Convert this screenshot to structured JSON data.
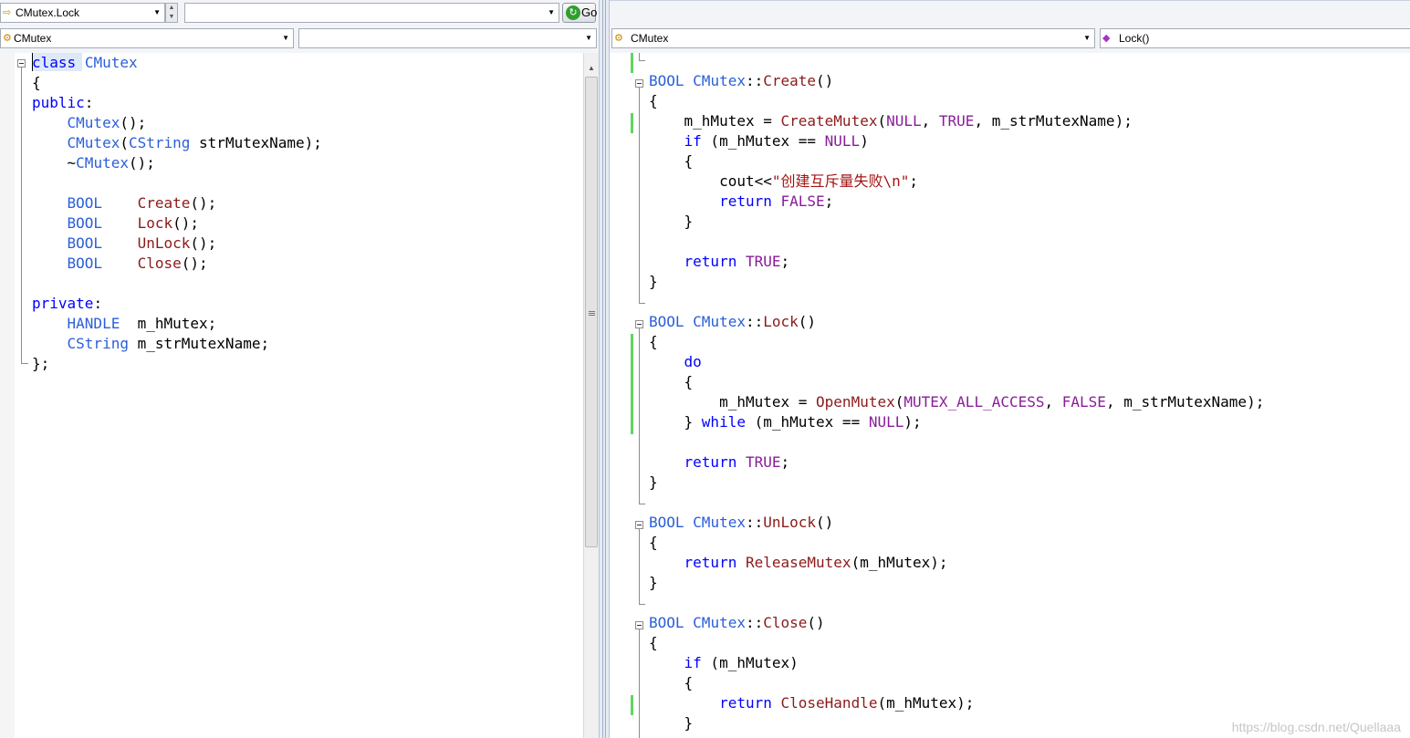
{
  "nav": {
    "location_combo": "CMutex.Lock",
    "location_combo2": "",
    "go_label": "Go"
  },
  "left_pane": {
    "class_combo": "CMutex",
    "member_combo": "",
    "code": [
      [
        [
          "kw",
          "class"
        ],
        [
          "op",
          " "
        ],
        [
          "ty",
          "CMutex"
        ]
      ],
      [
        [
          "op",
          "{"
        ]
      ],
      [
        [
          "kw",
          "public"
        ],
        [
          "op",
          ":"
        ]
      ],
      [
        [
          "op",
          "    "
        ],
        [
          "ty",
          "CMutex"
        ],
        [
          "op",
          "();"
        ]
      ],
      [
        [
          "op",
          "    "
        ],
        [
          "ty",
          "CMutex"
        ],
        [
          "op",
          "("
        ],
        [
          "ty",
          "CString"
        ],
        [
          "op",
          " strMutexName);"
        ]
      ],
      [
        [
          "op",
          "    ~"
        ],
        [
          "ty",
          "CMutex"
        ],
        [
          "op",
          "();"
        ]
      ],
      [
        [
          "op",
          ""
        ]
      ],
      [
        [
          "op",
          "    "
        ],
        [
          "ty",
          "BOOL"
        ],
        [
          "op",
          "    "
        ],
        [
          "fn",
          "Create"
        ],
        [
          "op",
          "();"
        ]
      ],
      [
        [
          "op",
          "    "
        ],
        [
          "ty",
          "BOOL"
        ],
        [
          "op",
          "    "
        ],
        [
          "fn",
          "Lock"
        ],
        [
          "op",
          "();"
        ]
      ],
      [
        [
          "op",
          "    "
        ],
        [
          "ty",
          "BOOL"
        ],
        [
          "op",
          "    "
        ],
        [
          "fn",
          "UnLock"
        ],
        [
          "op",
          "();"
        ]
      ],
      [
        [
          "op",
          "    "
        ],
        [
          "ty",
          "BOOL"
        ],
        [
          "op",
          "    "
        ],
        [
          "fn",
          "Close"
        ],
        [
          "op",
          "();"
        ]
      ],
      [
        [
          "op",
          ""
        ]
      ],
      [
        [
          "kw",
          "private"
        ],
        [
          "op",
          ":"
        ]
      ],
      [
        [
          "op",
          "    "
        ],
        [
          "ty",
          "HANDLE"
        ],
        [
          "op",
          "  m_hMutex;"
        ]
      ],
      [
        [
          "op",
          "    "
        ],
        [
          "ty",
          "CString"
        ],
        [
          "op",
          " m_strMutexName;"
        ]
      ],
      [
        [
          "op",
          "};"
        ]
      ]
    ]
  },
  "right_pane": {
    "class_combo": "CMutex",
    "member_combo": "Lock()",
    "code": [
      [
        [
          "op",
          ""
        ]
      ],
      [
        [
          "ty",
          "BOOL"
        ],
        [
          "op",
          " "
        ],
        [
          "ty",
          "CMutex"
        ],
        [
          "op",
          "::"
        ],
        [
          "fn",
          "Create"
        ],
        [
          "op",
          "()"
        ]
      ],
      [
        [
          "op",
          "{"
        ]
      ],
      [
        [
          "op",
          "    m_hMutex = "
        ],
        [
          "fn",
          "CreateMutex"
        ],
        [
          "op",
          "("
        ],
        [
          "mc",
          "NULL"
        ],
        [
          "op",
          ", "
        ],
        [
          "mc",
          "TRUE"
        ],
        [
          "op",
          ", m_strMutexName);"
        ]
      ],
      [
        [
          "op",
          "    "
        ],
        [
          "kw",
          "if"
        ],
        [
          "op",
          " (m_hMutex == "
        ],
        [
          "mc",
          "NULL"
        ],
        [
          "op",
          ")"
        ]
      ],
      [
        [
          "op",
          "    {"
        ]
      ],
      [
        [
          "op",
          "        cout<<"
        ],
        [
          "st",
          "\"创建互斥量失败\\n\""
        ],
        [
          "op",
          ";"
        ]
      ],
      [
        [
          "op",
          "        "
        ],
        [
          "kw",
          "return"
        ],
        [
          "op",
          " "
        ],
        [
          "mc",
          "FALSE"
        ],
        [
          "op",
          ";"
        ]
      ],
      [
        [
          "op",
          "    }"
        ]
      ],
      [
        [
          "op",
          ""
        ]
      ],
      [
        [
          "op",
          "    "
        ],
        [
          "kw",
          "return"
        ],
        [
          "op",
          " "
        ],
        [
          "mc",
          "TRUE"
        ],
        [
          "op",
          ";"
        ]
      ],
      [
        [
          "op",
          "}"
        ]
      ],
      [
        [
          "op",
          ""
        ]
      ],
      [
        [
          "ty",
          "BOOL"
        ],
        [
          "op",
          " "
        ],
        [
          "ty",
          "CMutex"
        ],
        [
          "op",
          "::"
        ],
        [
          "fn",
          "Lock"
        ],
        [
          "op",
          "()"
        ]
      ],
      [
        [
          "op",
          "{"
        ]
      ],
      [
        [
          "op",
          "    "
        ],
        [
          "kw",
          "do"
        ]
      ],
      [
        [
          "op",
          "    {"
        ]
      ],
      [
        [
          "op",
          "        m_hMutex = "
        ],
        [
          "fn",
          "OpenMutex"
        ],
        [
          "op",
          "("
        ],
        [
          "mc",
          "MUTEX_ALL_ACCESS"
        ],
        [
          "op",
          ", "
        ],
        [
          "mc",
          "FALSE"
        ],
        [
          "op",
          ", m_strMutexName);"
        ]
      ],
      [
        [
          "op",
          "    } "
        ],
        [
          "kw",
          "while"
        ],
        [
          "op",
          " (m_hMutex == "
        ],
        [
          "mc",
          "NULL"
        ],
        [
          "op",
          ");"
        ]
      ],
      [
        [
          "op",
          ""
        ]
      ],
      [
        [
          "op",
          "    "
        ],
        [
          "kw",
          "return"
        ],
        [
          "op",
          " "
        ],
        [
          "mc",
          "TRUE"
        ],
        [
          "op",
          ";"
        ]
      ],
      [
        [
          "op",
          "}"
        ]
      ],
      [
        [
          "op",
          ""
        ]
      ],
      [
        [
          "ty",
          "BOOL"
        ],
        [
          "op",
          " "
        ],
        [
          "ty",
          "CMutex"
        ],
        [
          "op",
          "::"
        ],
        [
          "fn",
          "UnLock"
        ],
        [
          "op",
          "()"
        ]
      ],
      [
        [
          "op",
          "{"
        ]
      ],
      [
        [
          "op",
          "    "
        ],
        [
          "kw",
          "return"
        ],
        [
          "op",
          " "
        ],
        [
          "fn",
          "ReleaseMutex"
        ],
        [
          "op",
          "(m_hMutex);"
        ]
      ],
      [
        [
          "op",
          "}"
        ]
      ],
      [
        [
          "op",
          ""
        ]
      ],
      [
        [
          "ty",
          "BOOL"
        ],
        [
          "op",
          " "
        ],
        [
          "ty",
          "CMutex"
        ],
        [
          "op",
          "::"
        ],
        [
          "fn",
          "Close"
        ],
        [
          "op",
          "()"
        ]
      ],
      [
        [
          "op",
          "{"
        ]
      ],
      [
        [
          "op",
          "    "
        ],
        [
          "kw",
          "if"
        ],
        [
          "op",
          " (m_hMutex)"
        ]
      ],
      [
        [
          "op",
          "    {"
        ]
      ],
      [
        [
          "op",
          "        "
        ],
        [
          "kw",
          "return"
        ],
        [
          "op",
          " "
        ],
        [
          "fn",
          "CloseHandle"
        ],
        [
          "op",
          "(m_hMutex);"
        ]
      ],
      [
        [
          "op",
          "    }"
        ]
      ]
    ]
  },
  "watermark": "https://blog.csdn.net/Quellaaa",
  "colors": {
    "keyword": "#0000ff",
    "type": "#2b5fd9",
    "function": "#8b1a1a",
    "macro": "#8a1c9a",
    "string": "#a31515",
    "change_bar": "#5fd65f"
  },
  "icons": {
    "location_icon": "arrow-icon",
    "class_icon": "class-icon",
    "member_icon": "method-icon",
    "go_icon": "go-arrow-icon"
  }
}
